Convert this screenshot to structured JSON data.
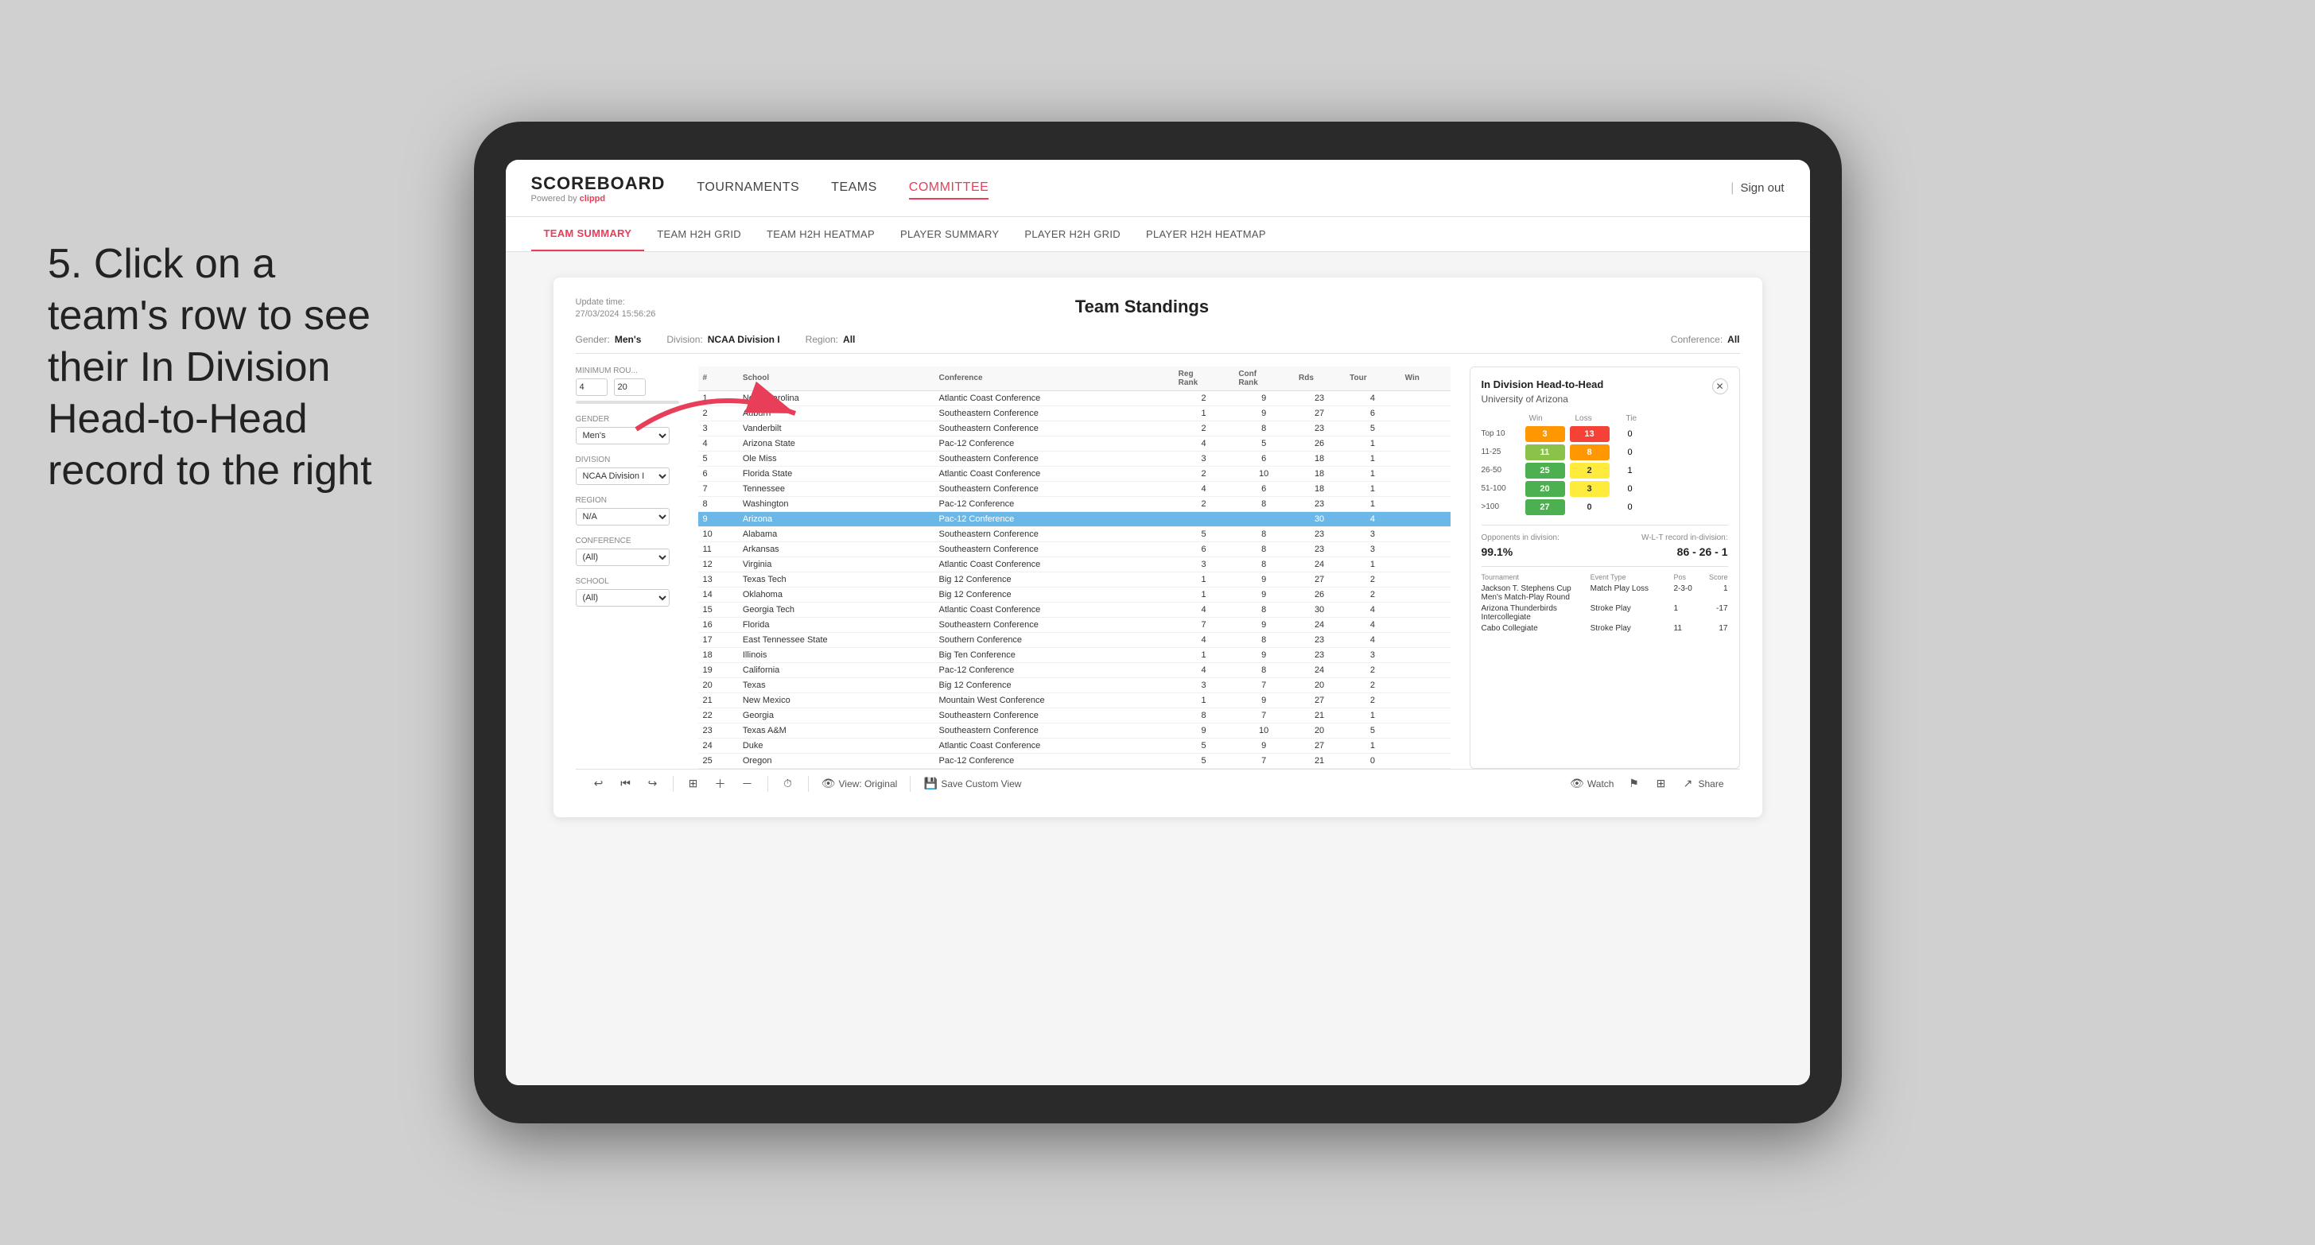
{
  "annotation": {
    "text": "5. Click on a team's row to see their In Division Head-to-Head record to the right"
  },
  "nav": {
    "logo": "SCOREBOARD",
    "powered_by": "Powered by clippd",
    "items": [
      {
        "label": "TOURNAMENTS",
        "active": false
      },
      {
        "label": "TEAMS",
        "active": false
      },
      {
        "label": "COMMITTEE",
        "active": true
      }
    ],
    "sign_out": "Sign out"
  },
  "sub_nav": {
    "items": [
      {
        "label": "TEAM SUMMARY",
        "active": true
      },
      {
        "label": "TEAM H2H GRID",
        "active": false
      },
      {
        "label": "TEAM H2H HEATMAP",
        "active": false
      },
      {
        "label": "PLAYER SUMMARY",
        "active": false
      },
      {
        "label": "PLAYER H2H GRID",
        "active": false
      },
      {
        "label": "PLAYER H2H HEATMAP",
        "active": false
      }
    ]
  },
  "card": {
    "update_label": "Update time:",
    "update_time": "27/03/2024 15:56:26",
    "title": "Team Standings",
    "filters": {
      "gender_label": "Gender:",
      "gender_value": "Men's",
      "division_label": "Division:",
      "division_value": "NCAA Division I",
      "region_label": "Region:",
      "region_value": "All",
      "conference_label": "Conference:",
      "conference_value": "All"
    }
  },
  "sidebar": {
    "min_rounds_label": "Minimum Rou...",
    "min_rounds_val1": "4",
    "min_rounds_val2": "20",
    "gender_label": "Gender",
    "gender_value": "Men's",
    "division_label": "Division",
    "division_value": "NCAA Division I",
    "region_label": "Region",
    "region_value": "N/A",
    "conference_label": "Conference",
    "conference_value": "(All)",
    "school_label": "School",
    "school_value": "(All)"
  },
  "table": {
    "headers": [
      "#",
      "School",
      "Conference",
      "Reg Rank",
      "Conf Rank",
      "Rds",
      "Tour",
      "Win"
    ],
    "rows": [
      {
        "num": 1,
        "school": "North Carolina",
        "conference": "Atlantic Coast Conference",
        "reg": 2,
        "conf": 9,
        "rds": 23,
        "tour": 4,
        "win": "",
        "highlighted": false
      },
      {
        "num": 2,
        "school": "Auburn",
        "conference": "Southeastern Conference",
        "reg": 1,
        "conf": 9,
        "rds": 27,
        "tour": 6,
        "win": "",
        "highlighted": false
      },
      {
        "num": 3,
        "school": "Vanderbilt",
        "conference": "Southeastern Conference",
        "reg": 2,
        "conf": 8,
        "rds": 23,
        "tour": 5,
        "win": "",
        "highlighted": false
      },
      {
        "num": 4,
        "school": "Arizona State",
        "conference": "Pac-12 Conference",
        "reg": 4,
        "conf": 5,
        "rds": 26,
        "tour": 1,
        "win": "",
        "highlighted": false
      },
      {
        "num": 5,
        "school": "Ole Miss",
        "conference": "Southeastern Conference",
        "reg": 3,
        "conf": 6,
        "rds": 18,
        "tour": 1,
        "win": "",
        "highlighted": false
      },
      {
        "num": 6,
        "school": "Florida State",
        "conference": "Atlantic Coast Conference",
        "reg": 2,
        "conf": 10,
        "rds": 18,
        "tour": 1,
        "win": "",
        "highlighted": false
      },
      {
        "num": 7,
        "school": "Tennessee",
        "conference": "Southeastern Conference",
        "reg": 4,
        "conf": 6,
        "rds": 18,
        "tour": 1,
        "win": "",
        "highlighted": false
      },
      {
        "num": 8,
        "school": "Washington",
        "conference": "Pac-12 Conference",
        "reg": 2,
        "conf": 8,
        "rds": 23,
        "tour": 1,
        "win": "",
        "highlighted": false
      },
      {
        "num": 9,
        "school": "Arizona",
        "conference": "Pac-12 Conference",
        "reg": "",
        "conf": "",
        "rds": 30,
        "tour": 4,
        "win": "",
        "highlighted": true
      },
      {
        "num": 10,
        "school": "Alabama",
        "conference": "Southeastern Conference",
        "reg": 5,
        "conf": 8,
        "rds": 23,
        "tour": 3,
        "win": "",
        "highlighted": false
      },
      {
        "num": 11,
        "school": "Arkansas",
        "conference": "Southeastern Conference",
        "reg": 6,
        "conf": 8,
        "rds": 23,
        "tour": 3,
        "win": "",
        "highlighted": false
      },
      {
        "num": 12,
        "school": "Virginia",
        "conference": "Atlantic Coast Conference",
        "reg": 3,
        "conf": 8,
        "rds": 24,
        "tour": 1,
        "win": "",
        "highlighted": false
      },
      {
        "num": 13,
        "school": "Texas Tech",
        "conference": "Big 12 Conference",
        "reg": 1,
        "conf": 9,
        "rds": 27,
        "tour": 2,
        "win": "",
        "highlighted": false
      },
      {
        "num": 14,
        "school": "Oklahoma",
        "conference": "Big 12 Conference",
        "reg": 1,
        "conf": 9,
        "rds": 26,
        "tour": 2,
        "win": "",
        "highlighted": false
      },
      {
        "num": 15,
        "school": "Georgia Tech",
        "conference": "Atlantic Coast Conference",
        "reg": 4,
        "conf": 8,
        "rds": 30,
        "tour": 4,
        "win": "",
        "highlighted": false
      },
      {
        "num": 16,
        "school": "Florida",
        "conference": "Southeastern Conference",
        "reg": 7,
        "conf": 9,
        "rds": 24,
        "tour": 4,
        "win": "",
        "highlighted": false
      },
      {
        "num": 17,
        "school": "East Tennessee State",
        "conference": "Southern Conference",
        "reg": 4,
        "conf": 8,
        "rds": 23,
        "tour": 4,
        "win": "",
        "highlighted": false
      },
      {
        "num": 18,
        "school": "Illinois",
        "conference": "Big Ten Conference",
        "reg": 1,
        "conf": 9,
        "rds": 23,
        "tour": 3,
        "win": "",
        "highlighted": false
      },
      {
        "num": 19,
        "school": "California",
        "conference": "Pac-12 Conference",
        "reg": 4,
        "conf": 8,
        "rds": 24,
        "tour": 2,
        "win": "",
        "highlighted": false
      },
      {
        "num": 20,
        "school": "Texas",
        "conference": "Big 12 Conference",
        "reg": 3,
        "conf": 7,
        "rds": 20,
        "tour": 2,
        "win": "",
        "highlighted": false
      },
      {
        "num": 21,
        "school": "New Mexico",
        "conference": "Mountain West Conference",
        "reg": 1,
        "conf": 9,
        "rds": 27,
        "tour": 2,
        "win": "",
        "highlighted": false
      },
      {
        "num": 22,
        "school": "Georgia",
        "conference": "Southeastern Conference",
        "reg": 8,
        "conf": 7,
        "rds": 21,
        "tour": 1,
        "win": "",
        "highlighted": false
      },
      {
        "num": 23,
        "school": "Texas A&M",
        "conference": "Southeastern Conference",
        "reg": 9,
        "conf": 10,
        "rds": 20,
        "tour": 5,
        "win": "",
        "highlighted": false
      },
      {
        "num": 24,
        "school": "Duke",
        "conference": "Atlantic Coast Conference",
        "reg": 5,
        "conf": 9,
        "rds": 27,
        "tour": 1,
        "win": "",
        "highlighted": false
      },
      {
        "num": 25,
        "school": "Oregon",
        "conference": "Pac-12 Conference",
        "reg": 5,
        "conf": 7,
        "rds": 21,
        "tour": 0,
        "win": "",
        "highlighted": false
      }
    ]
  },
  "h2h": {
    "title": "In Division Head-to-Head",
    "subtitle": "University of Arizona",
    "win_label": "Win",
    "loss_label": "Loss",
    "tie_label": "Tie",
    "rows": [
      {
        "range": "Top 10",
        "win": 3,
        "loss": 13,
        "tie": 0,
        "win_color": "orange",
        "loss_color": "red"
      },
      {
        "range": "11-25",
        "win": 11,
        "loss": 8,
        "tie": 0,
        "win_color": "light-green",
        "loss_color": "orange"
      },
      {
        "range": "26-50",
        "win": 25,
        "loss": 2,
        "tie": 1,
        "win_color": "green",
        "loss_color": "yellow"
      },
      {
        "range": "51-100",
        "win": 20,
        "loss": 3,
        "tie": 0,
        "win_color": "green",
        "loss_color": "yellow"
      },
      {
        "range": ">100",
        "win": 27,
        "loss": 0,
        "tie": 0,
        "win_color": "green",
        "loss_color": "white"
      }
    ],
    "opponents_label": "Opponents in division:",
    "opponents_value": "99.1%",
    "wlt_label": "W-L-T record in-division:",
    "wlt_value": "86 - 26 - 1",
    "tournament_label": "Tournament",
    "event_type_label": "Event Type",
    "pos_label": "Pos",
    "score_label": "Score",
    "tournaments": [
      {
        "name": "Jackson T. Stephens Cup Men's Match-Play Round",
        "event_type": "Match Play",
        "result": "Loss",
        "pos": "2-3-0",
        "score": "1"
      },
      {
        "name": "Arizona Thunderbirds Intercollegiate",
        "event_type": "Stroke Play",
        "result": "",
        "pos": "1",
        "score": "-17"
      },
      {
        "name": "Cabo Collegiate",
        "event_type": "Stroke Play",
        "result": "",
        "pos": "11",
        "score": "17"
      }
    ]
  },
  "toolbar": {
    "undo": "↩",
    "redo": "↪",
    "view_original": "View: Original",
    "save_custom": "Save Custom View",
    "watch": "Watch",
    "share": "Share"
  },
  "colors": {
    "accent": "#e83e5a",
    "highlighted_row": "#6bb8e8",
    "green": "#4caf50",
    "light_green": "#8bc34a",
    "orange": "#ff9800",
    "red": "#f44336",
    "yellow": "#ffeb3b"
  }
}
